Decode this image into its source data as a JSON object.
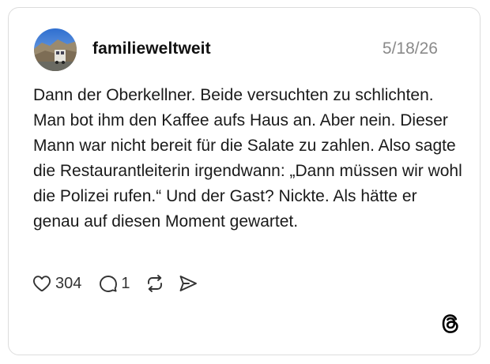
{
  "post": {
    "username": "familieweltweit",
    "date": "5/18/26",
    "text": "Dann der Oberkellner. Beide versuchten zu schlichten. Man bot ihm den Kaffee aufs Haus an. Aber nein. Dieser Mann war nicht bereit für die Salate zu zahlen. Also sagte die Restaurantleiterin irgendwann: „Dann müssen wir wohl die Polizei rufen.“ Und der Gast? Nickte. Als hätte er genau auf diesen Moment gewartet."
  },
  "actions": {
    "like_count": "304",
    "reply_count": "1",
    "icons": [
      "heart-icon",
      "comment-icon",
      "repost-icon",
      "share-icon"
    ]
  },
  "branding": {
    "logo": "threads-logo-icon"
  },
  "colors": {
    "text": "#111111",
    "date": "#8a8a8a",
    "border": "#dcdcdc",
    "icon": "#333333"
  }
}
